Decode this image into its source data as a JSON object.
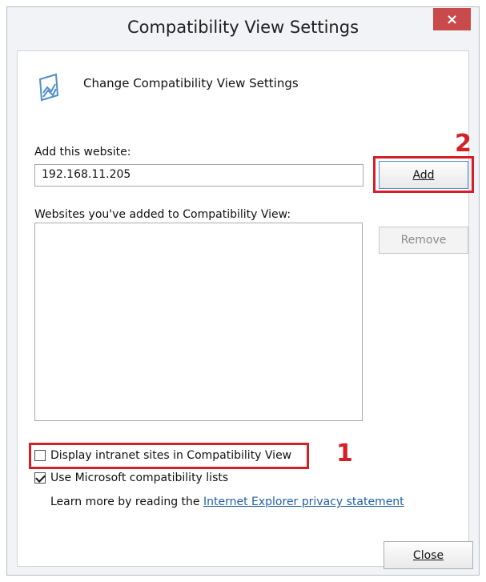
{
  "window": {
    "title": "Compatibility View Settings",
    "close_label": "×"
  },
  "header": {
    "icon": "compatibility-view-icon",
    "text": "Change Compatibility View Settings"
  },
  "form": {
    "add_label": "Add this website:",
    "website_value": "192.168.11.205",
    "add_button_label": "Add",
    "list_label": "Websites you've added to Compatibility View:",
    "remove_button_label": "Remove"
  },
  "options": {
    "intranet_label": "Display intranet sites in Compatibility View",
    "intranet_checked": false,
    "microsoft_label": "Use Microsoft compatibility lists",
    "microsoft_checked": true,
    "learn_more_prefix": "Learn more by reading the",
    "privacy_link_text": "Internet Explorer privacy statement"
  },
  "footer": {
    "close_button_label": "Close"
  },
  "annotations": {
    "callout_1": "1",
    "callout_2": "2"
  },
  "colors": {
    "accent_red": "#d61f26",
    "link_blue": "#1f5ea8",
    "close_button_red": "#c94a4a"
  }
}
